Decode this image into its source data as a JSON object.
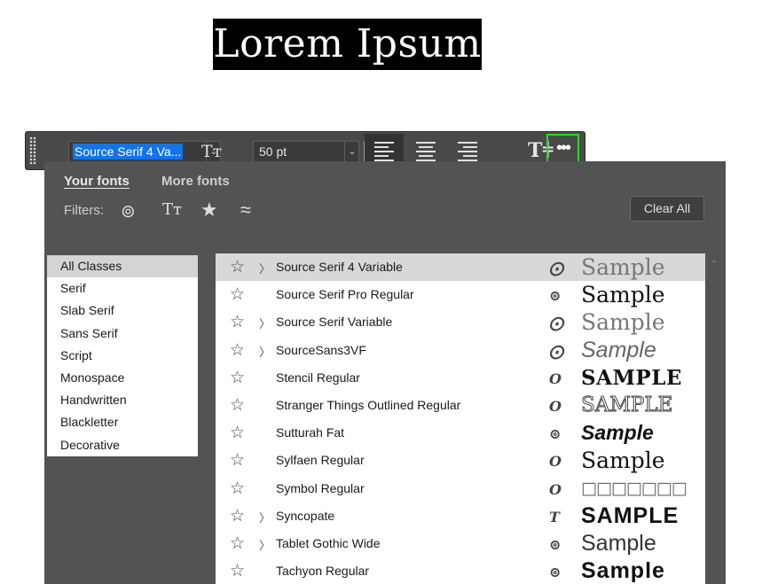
{
  "canvas": {
    "text": "Lorem Ipsum"
  },
  "toolbar": {
    "font_family_value": "Source Serif 4 Va...",
    "font_size_value": "50 pt",
    "color": "#000000",
    "icons": [
      "grip-icon",
      "chevron-down-icon",
      "font-size-icon",
      "chevron-down-icon",
      "align-left-icon",
      "align-center-icon",
      "align-right-icon",
      "text-options-icon",
      "more-icon"
    ]
  },
  "panel": {
    "tabs": [
      "Your fonts",
      "More fonts"
    ],
    "filters_label": "Filters:",
    "filter_icons": [
      "creative-cloud-icon",
      "font-size-filter-icon",
      "star-icon",
      "similar-icon"
    ],
    "clear_all": "Clear All",
    "classes": [
      "All Classes",
      "Serif",
      "Slab Serif",
      "Sans Serif",
      "Script",
      "Monospace",
      "Handwritten",
      "Blackletter",
      "Decorative"
    ],
    "selected_class": "All Classes",
    "fonts": [
      {
        "name": "Source Serif 4 Variable",
        "expandable": true,
        "icon": "variable-font-icon",
        "sample": "Sample",
        "selected": true
      },
      {
        "name": "Source Serif Pro Regular",
        "expandable": false,
        "icon": "creative-cloud-icon",
        "sample": "Sample"
      },
      {
        "name": "Source Serif Variable",
        "expandable": true,
        "icon": "variable-font-icon",
        "sample": "Sample"
      },
      {
        "name": "SourceSans3VF",
        "expandable": true,
        "icon": "variable-font-icon",
        "sample": "Sample"
      },
      {
        "name": "Stencil Regular",
        "expandable": false,
        "icon": "opentype-icon",
        "sample": "SAMPLE"
      },
      {
        "name": "Stranger Things Outlined Regular",
        "expandable": false,
        "icon": "opentype-icon",
        "sample": "SAMPLE"
      },
      {
        "name": "Sutturah Fat",
        "expandable": false,
        "icon": "creative-cloud-icon",
        "sample": "Sample"
      },
      {
        "name": "Sylfaen Regular",
        "expandable": false,
        "icon": "opentype-icon",
        "sample": "Sample"
      },
      {
        "name": "Symbol Regular",
        "expandable": false,
        "icon": "opentype-icon",
        "sample": "□□□□□□□"
      },
      {
        "name": "Syncopate",
        "expandable": true,
        "icon": "truetype-icon",
        "sample": "SAMPLE"
      },
      {
        "name": "Tablet Gothic Wide",
        "expandable": true,
        "icon": "creative-cloud-icon",
        "sample": "Sample"
      },
      {
        "name": "Tachyon Regular",
        "expandable": false,
        "icon": "creative-cloud-icon",
        "sample": "Sample"
      }
    ]
  }
}
